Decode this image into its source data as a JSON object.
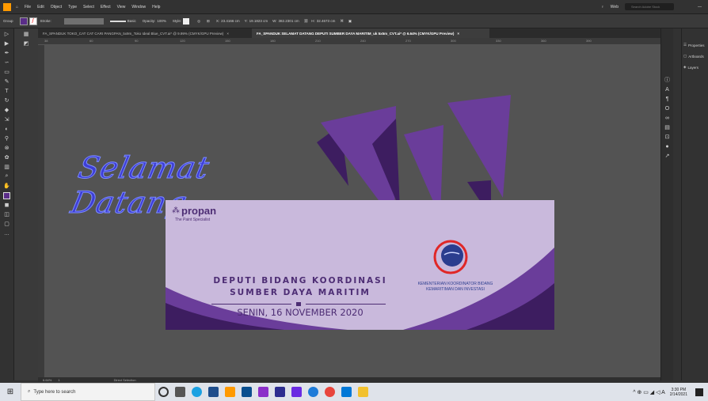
{
  "menubar": {
    "items": [
      "File",
      "Edit",
      "Object",
      "Type",
      "Select",
      "Effect",
      "View",
      "Window",
      "Help"
    ],
    "workspace": "Web",
    "search_placeholder": "Search Adobe Stock"
  },
  "optbar": {
    "selection": "Group",
    "stroke_label": "Stroke:",
    "brush": "Basic",
    "opacity_label": "Opacity:",
    "opacity_value": "100%",
    "style_label": "Style:",
    "x_label": "X:",
    "x_value": "23.4166 cm",
    "y_label": "Y:",
    "y_value": "19.1823 cm",
    "w_label": "W:",
    "w_value": "382.2301 cm",
    "h_label": "H:",
    "h_value": "32.4673 cm"
  },
  "tabs": [
    {
      "label": "FA_SPANDUK TOKO_CAT CAT CARI PANGPAN_5x9m_Toko Ideal Blue_CVT.ai* @ 9.99% (CMYK/GPU Preview)",
      "active": false
    },
    {
      "label": "FA_SPANDUK SELAMAT DATANG DEPUTI SUMBER DAYA MARITIM_uk 5x5m_CVT.ai* @ 6.64% (CMYK/GPU Preview)",
      "active": true
    }
  ],
  "ruler_marks": [
    "38",
    "60",
    "90",
    "120",
    "150",
    "180",
    "210",
    "240",
    "270",
    "300",
    "330",
    "360",
    "390"
  ],
  "artwork": {
    "script_text": "Selamat Datang",
    "brand_name": "propan",
    "brand_tagline": "The Paint Specialist",
    "title_line1": "DEPUTI BIDANG KOORDINASI",
    "title_line2": "SUMBER DAYA MARITIM",
    "date_line": "SENIN, 16 NOVEMBER 2020",
    "ministry_line1": "KEMENTERIAN KOORDINATOR BIDANG",
    "ministry_line2": "KEMARITIMAN DAN INVESTASI",
    "accent_color": "#6a3d9a",
    "banner_color": "#c9b9dc"
  },
  "panels": {
    "items": [
      "Properties",
      "Artboards",
      "Layers"
    ]
  },
  "statusbar": {
    "zoom": "6.64%",
    "page": "1",
    "tool": "Direct Selection"
  },
  "taskbar": {
    "search_placeholder": "Type here to search",
    "time": "3:30 PM",
    "date": "2/14/2021"
  }
}
